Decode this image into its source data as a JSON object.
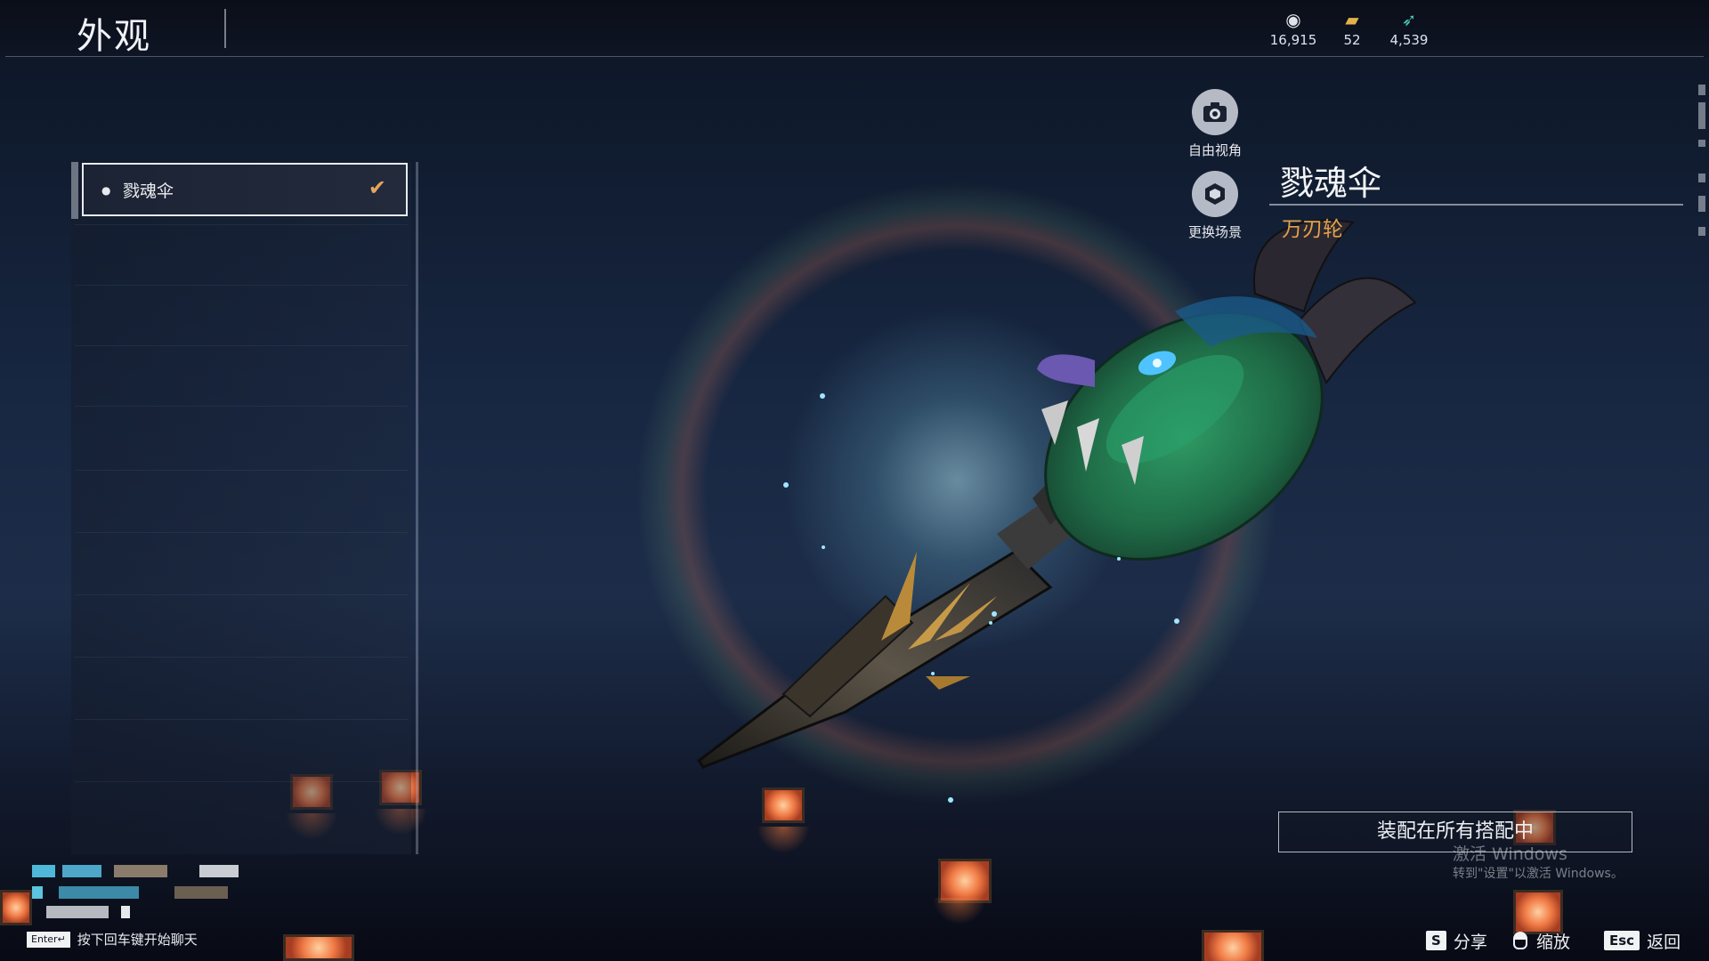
{
  "header": {
    "title": "外观"
  },
  "currencies": [
    {
      "icon": "coin-pouch-icon",
      "value": "16,915",
      "color": "#dfe3ea"
    },
    {
      "icon": "gold-ticket-icon",
      "value": "52",
      "color": "#e4b24a"
    },
    {
      "icon": "jade-feather-icon",
      "value": "4,539",
      "color": "#4fc3b6"
    }
  ],
  "skin_list": {
    "selected_item": {
      "label": "戮魂伞",
      "equipped": true
    }
  },
  "side_actions": {
    "free_camera_label": "自由视角",
    "change_scene_label": "更换场景"
  },
  "item": {
    "name": "戮魂伞",
    "weapon_type": "万刃轮"
  },
  "equip_button_label": "装配在所有搭配中",
  "watermark": {
    "line1": "激活 Windows",
    "line2": "转到\"设置\"以激活 Windows。"
  },
  "footer": {
    "chat_key": "Enter↵",
    "chat_hint": "按下回车键开始聊天",
    "share_key": "S",
    "share_label": "分享",
    "zoom_label": "缩放",
    "back_key": "Esc",
    "back_label": "返回"
  },
  "colors": {
    "accent_orange": "#e4a24a",
    "check_orange": "#e4a55c"
  }
}
